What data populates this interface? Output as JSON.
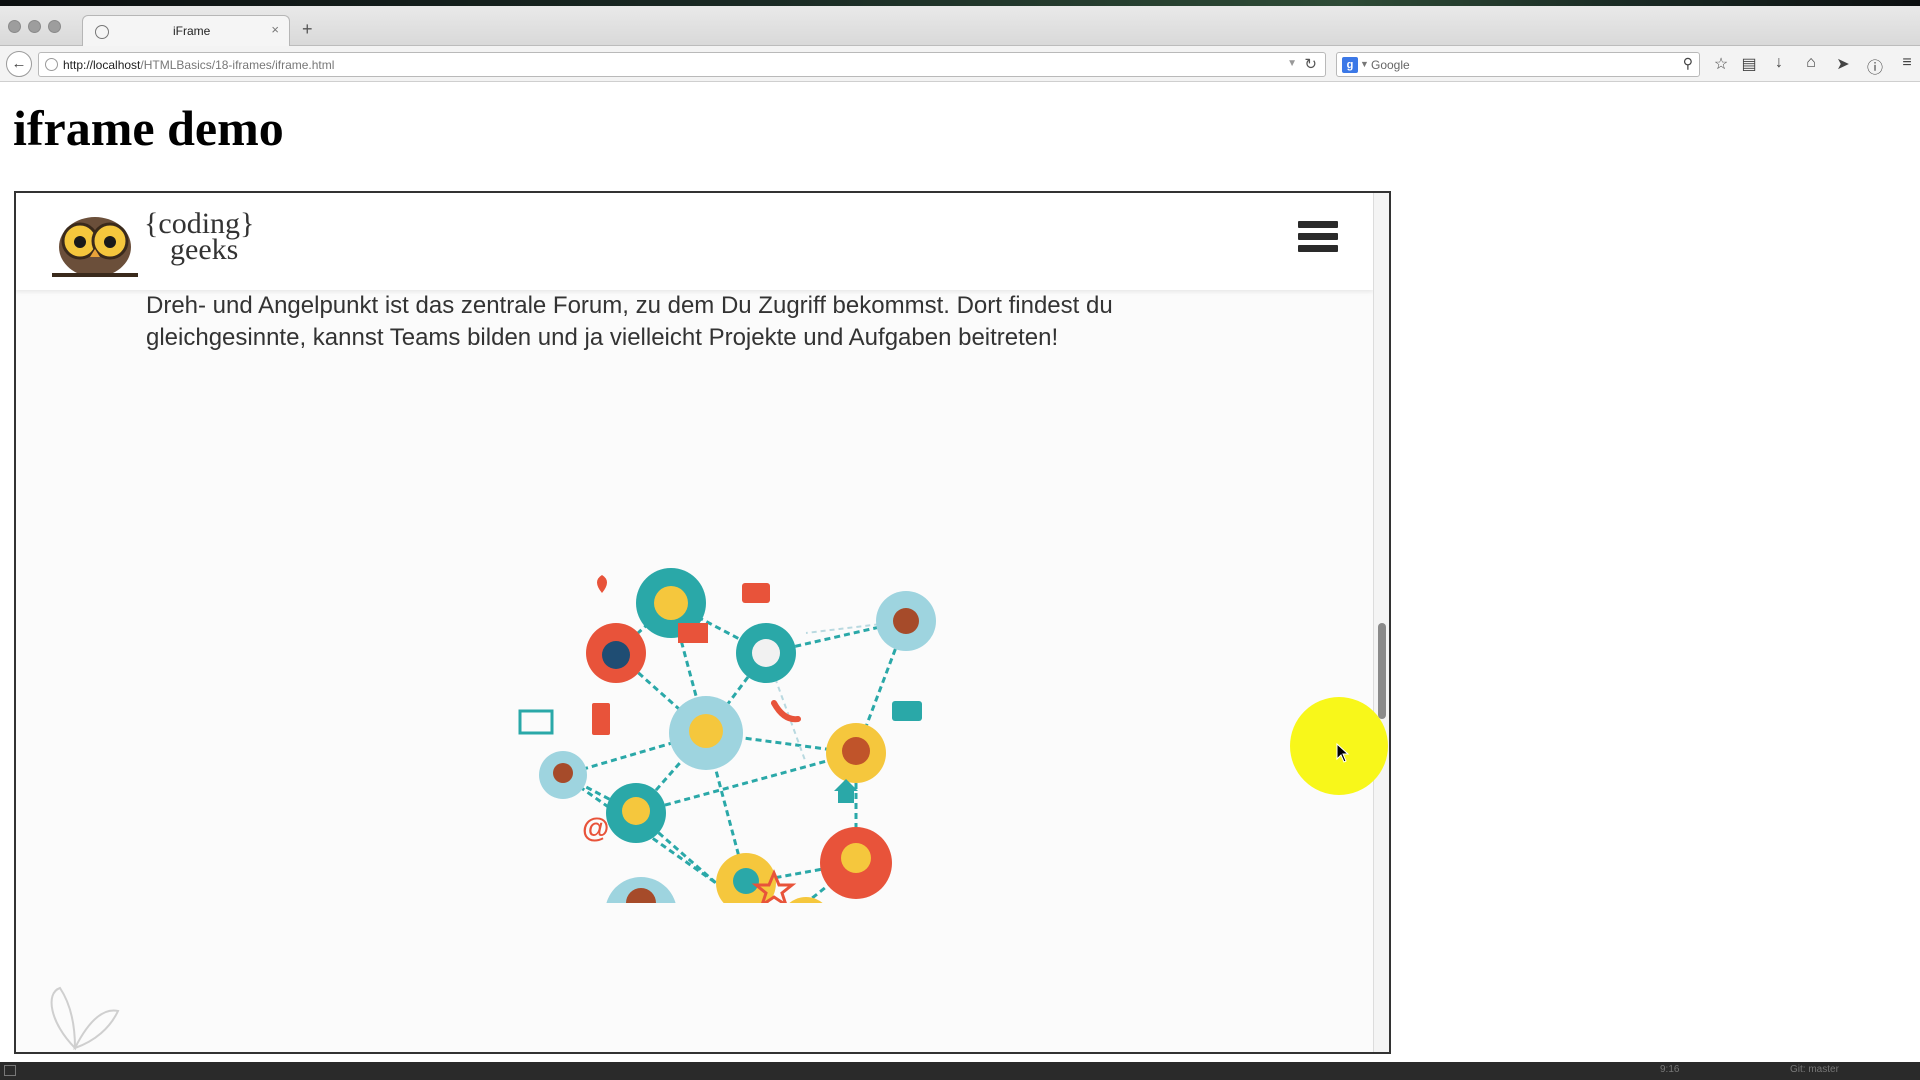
{
  "browser": {
    "tab_title": "iFrame",
    "tab_close": "×",
    "new_tab": "+",
    "url_host": "http://localhost",
    "url_path": "/HTMLBasics/18-iframes/iframe.html",
    "search_placeholder": "Google",
    "search_engine_letter": "g"
  },
  "page": {
    "title": "iframe demo"
  },
  "iframe": {
    "logo_text_line1": "{coding}",
    "logo_text_line2": "geeks",
    "intro": "Dreh- und Angelpunkt ist das zentrale Forum, zu dem Du Zugriff bekommst. Dort findest du gleichgesinnte, kannst Teams bilden und ja vielleicht Projekte und Aufgaben beitreten!"
  },
  "statusbar": {
    "time": "9:16",
    "git": "Git: master"
  },
  "colors": {
    "teal": "#2aa8a8",
    "orange": "#e8533a",
    "yellow": "#f5c73d",
    "lightblue": "#9ed4df",
    "highlight": "#f8f71a"
  }
}
